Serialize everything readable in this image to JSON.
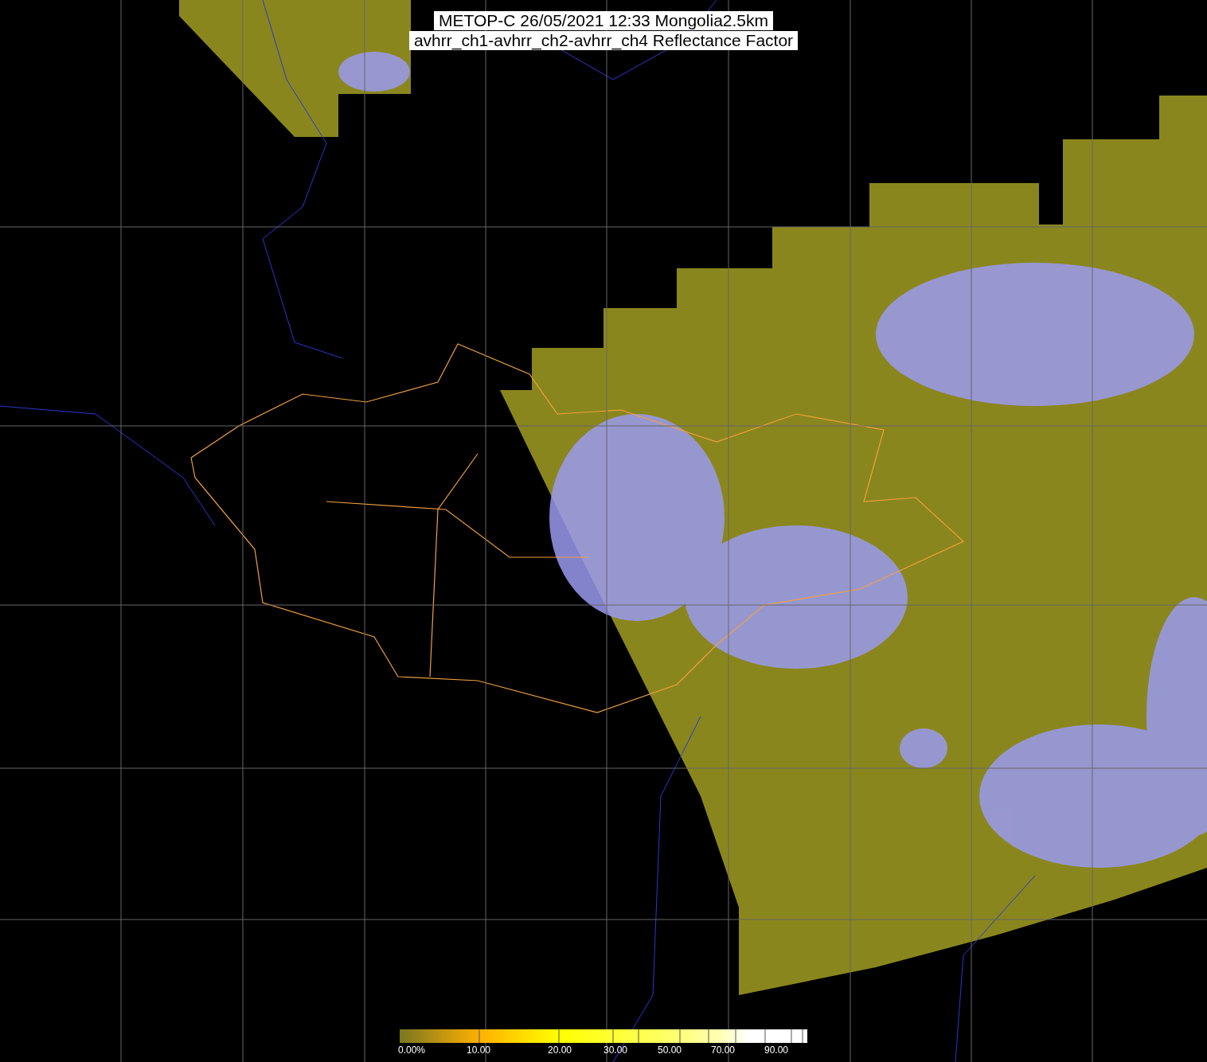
{
  "title": {
    "line_1": "METOP-C 26/05/2021 12:33 Mongolia2.5km",
    "line_2": "avhrr_ch1-avhrr_ch2-avhrr_ch4 Reflectance Factor"
  },
  "color_bar": {
    "labels": [
      "0.00%",
      "10.00",
      "20.00",
      "30.00",
      "50.00",
      "70.00",
      "90.00"
    ]
  }
}
